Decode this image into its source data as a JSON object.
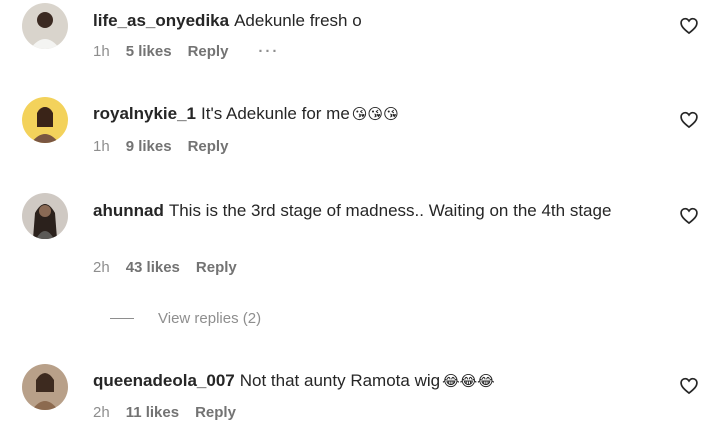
{
  "comments": [
    {
      "username": "life_as_onyedika",
      "text": "Adekunle fresh o",
      "emoji": "",
      "time": "1h",
      "likes": "5 likes",
      "reply": "Reply",
      "more": "···"
    },
    {
      "username": "royalnykie_1",
      "text": "It's Adekunle for me",
      "emoji": "😘😘😘",
      "time": "1h",
      "likes": "9 likes",
      "reply": "Reply"
    },
    {
      "username": "ahunnad",
      "text": "This is the 3rd stage of madness.. Waiting on the 4th stage",
      "emoji": "",
      "time": "2h",
      "likes": "43 likes",
      "reply": "Reply"
    },
    {
      "username": "queenadeola_007",
      "text": "Not that aunty Ramota wig",
      "emoji": "😂😂😂",
      "time": "2h",
      "likes": "11 likes",
      "reply": "Reply"
    }
  ],
  "view_replies": "View replies (2)",
  "icons": {
    "like": "heart-outline-icon"
  },
  "colors": {
    "text": "#262626",
    "meta": "#8e8e8e"
  }
}
